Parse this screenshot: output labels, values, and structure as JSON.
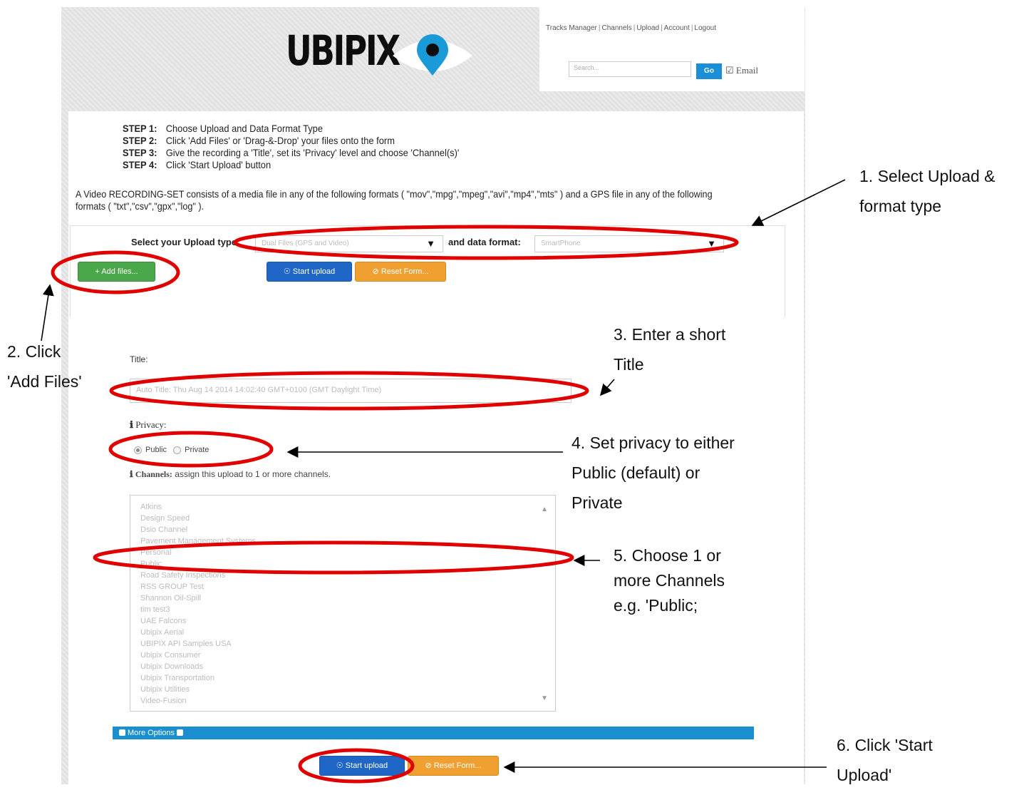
{
  "header": {
    "logo_text": "UBIPIX",
    "nav": [
      "Tracks Manager",
      "Channels",
      "Upload",
      "Account",
      "Logout"
    ],
    "search_placeholder": "Search...",
    "go_label": "Go",
    "email_label": "Email"
  },
  "steps": [
    {
      "num": "STEP 1:",
      "text": "Choose Upload and Data Format Type"
    },
    {
      "num": "STEP 2:",
      "text": "Click 'Add Files' or 'Drag-&-Drop' your files onto the form"
    },
    {
      "num": "STEP 3:",
      "text": "Give the recording a 'Title', set its 'Privacy' level and choose 'Channel(s)'"
    },
    {
      "num": "STEP 4:",
      "text": "Click 'Start Upload' button"
    }
  ],
  "description": "A Video RECORDING-SET consists of a media file in any of the following formats ( \"mov\",\"mpg\",\"mpeg\",\"avi\",\"mp4\",\"mts\" ) and a GPS file in any of the following formats ( \"txt\",\"csv\",\"gpx\",\"log\" ).",
  "upload": {
    "type_label": "Select your Upload type:",
    "type_value": "Dual Files (GPS and Video)",
    "format_label": "and data format:",
    "format_value": "SmartPhone",
    "add_files": "+ Add files...",
    "start_upload": "Start upload",
    "reset_form": "Reset Form..."
  },
  "form": {
    "title_label": "Title:",
    "title_value": "Auto Title: Thu Aug 14 2014 14:02:40 GMT+0100 (GMT Daylight Time)",
    "privacy_label": "Privacy:",
    "privacy_options": [
      "Public",
      "Private"
    ],
    "privacy_selected": "Public",
    "channels_label": "Channels:",
    "channels_hint": "assign this upload to 1 or more channels.",
    "channels": [
      "Atkins",
      "Design Speed",
      "Dsio Channel",
      "Pavement Management Systems",
      "Personal",
      "Public",
      "Road Safety Inspections",
      "RSS GROUP Test",
      "Shannon Oil-Spill",
      "tim test3",
      "UAE Falcons",
      "Ubipix Aerial",
      "UBIPIX API Samples USA",
      "Ubipix Consumer",
      "Ubipix Downloads",
      "Ubipix Transportation",
      "Ubipix Utilities",
      "Video-Fusion"
    ],
    "more_options": "More Options"
  },
  "callouts": {
    "c1": [
      "1. Select Upload &",
      "format type"
    ],
    "c2": [
      "2.  Click",
      "'Add Files'"
    ],
    "c3": [
      "3. Enter a short",
      "Title"
    ],
    "c4": [
      "4. Set privacy to either",
      "Public (default) or",
      "Private"
    ],
    "c5": [
      "5. Choose 1 or",
      "more Channels",
      "e.g. 'Public;"
    ],
    "c6": [
      "6. Click 'Start",
      "Upload'"
    ]
  },
  "colors": {
    "highlight_ellipse": "#e00000",
    "primary_button": "#1f66c6",
    "add_button": "#4aa84a",
    "reset_button": "#f0a030",
    "options_bar": "#1a8fcf",
    "go_button": "#1a8ed6"
  }
}
